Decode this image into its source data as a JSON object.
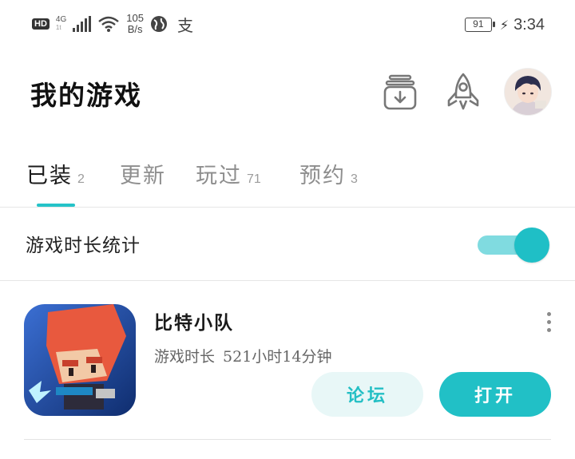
{
  "status_bar": {
    "hd": "HD",
    "network": "4G",
    "network_sub": "1t",
    "speed_value": "105",
    "speed_unit": "B/s",
    "extra_glyph": "支",
    "battery": "91",
    "time": "3:34"
  },
  "header": {
    "title": "我的游戏",
    "icons": [
      "download-manager-icon",
      "rocket-icon"
    ],
    "avatar": "user-avatar"
  },
  "tabs": [
    {
      "label": "已装",
      "count": "2",
      "active": true
    },
    {
      "label": "更新",
      "count": "",
      "active": false
    },
    {
      "label": "玩过",
      "count": "71",
      "active": false
    },
    {
      "label": "预约",
      "count": "3",
      "active": false
    }
  ],
  "playtime_stats": {
    "label": "游戏时长统计",
    "enabled": true
  },
  "games": [
    {
      "name": "比特小队",
      "playtime_label": "游戏时长",
      "playtime_value": "521小时14分钟",
      "forum_button": "论坛",
      "open_button": "打开"
    }
  ],
  "colors": {
    "accent": "#21c0c6",
    "accent_light": "#e8f7f7",
    "toggle_track": "#80dbe0"
  }
}
